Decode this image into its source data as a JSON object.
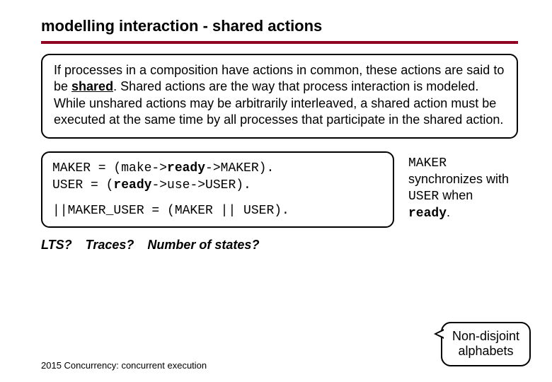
{
  "title": "modelling interaction - shared actions",
  "definition": {
    "part1": "If processes in a composition have actions in common, these actions are said to be ",
    "shared_word": "shared",
    "part2": ".  Shared actions are the way that process interaction is modeled. While unshared actions may be arbitrarily interleaved, a shared action must be executed at the same time by all processes that participate in the shared action."
  },
  "code": {
    "maker_pre": "MAKER = (make->",
    "maker_ready": "ready",
    "maker_post": "->MAKER).",
    "user_pre": "USER  = (",
    "user_ready": "ready",
    "user_post": "->use->USER).",
    "compose": "||MAKER_USER = (MAKER || USER)."
  },
  "sync_note": {
    "maker": "MAKER",
    "line1": "synchronizes with ",
    "user": "USER",
    "line2": " when ",
    "ready": "ready",
    "period": "."
  },
  "questions": {
    "q1": "LTS?",
    "q2": "Traces?",
    "q3": "Number of states?"
  },
  "callout": {
    "line1": "Non-disjoint",
    "line2": "alphabets"
  },
  "footer": "2015  Concurrency: concurrent execution"
}
